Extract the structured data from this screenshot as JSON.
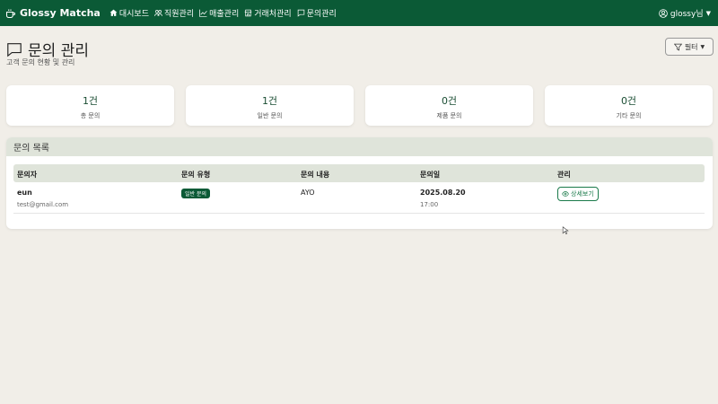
{
  "navbar": {
    "brand": "Glossy Matcha",
    "items": [
      {
        "label": "대시보드",
        "icon": "house-icon"
      },
      {
        "label": "직원관리",
        "icon": "people-icon"
      },
      {
        "label": "매출관리",
        "icon": "chart-line-icon"
      },
      {
        "label": "거래처관리",
        "icon": "shop-icon"
      },
      {
        "label": "문의관리",
        "icon": "chat-icon"
      }
    ],
    "user": "glossy님"
  },
  "page": {
    "title": "문의 관리",
    "subtitle": "고객 문의 현황 및 관리",
    "filter_label": "필터"
  },
  "stats": [
    {
      "value": "1건",
      "label": "총 문의"
    },
    {
      "value": "1건",
      "label": "일반 문의"
    },
    {
      "value": "0건",
      "label": "제품 문의"
    },
    {
      "value": "0건",
      "label": "기타 문의"
    }
  ],
  "list": {
    "title": "문의 목록",
    "columns": [
      "문의자",
      "문의 유형",
      "문의 내용",
      "문의일",
      "관리"
    ],
    "rows": [
      {
        "name": "eun",
        "email": "test@gmail.com",
        "type": "일반 문의",
        "content": "AYO",
        "date": "2025.08.20",
        "time": "17:00",
        "action": "상세보기"
      }
    ]
  },
  "colors": {
    "primary": "#0b5a36",
    "background": "#f1eee8",
    "header_bg": "#dfe4da"
  }
}
